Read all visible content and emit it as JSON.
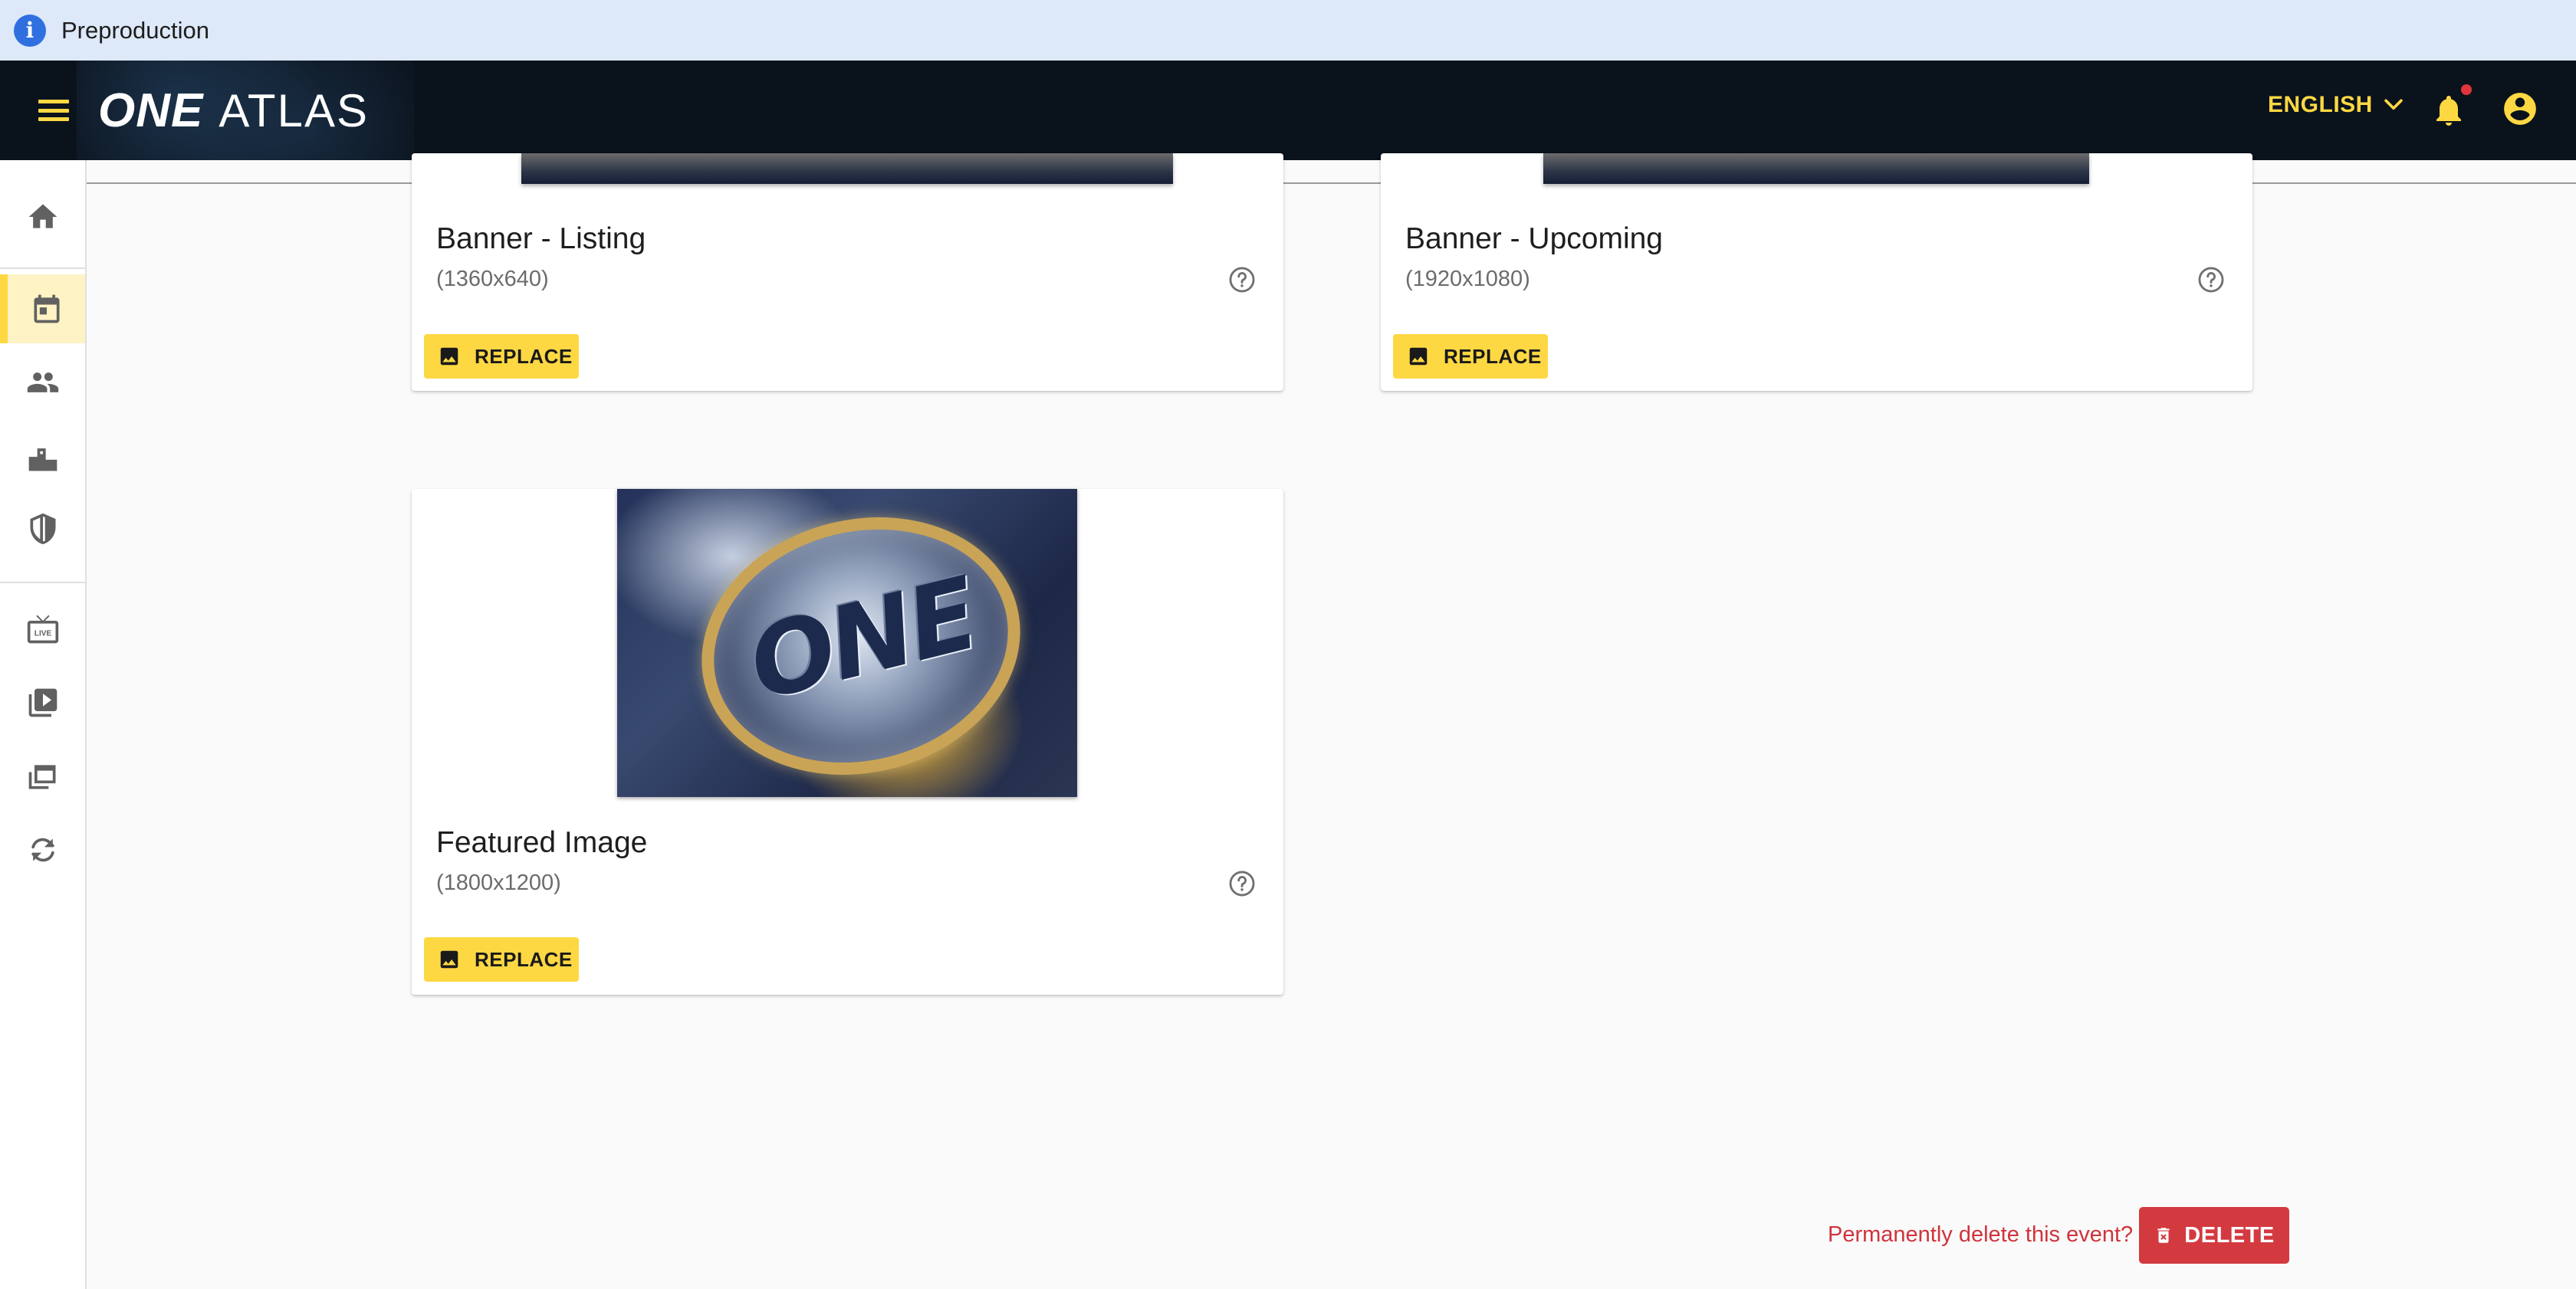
{
  "env_banner": {
    "icon": "info-icon",
    "text": "Preproduction"
  },
  "appbar": {
    "logo_one": "ONE",
    "logo_atlas": "ATLAS",
    "language": "ENGLISH",
    "colors": {
      "accent": "#fed843",
      "bar": "#0a121c",
      "notification_dot": "#e0353b"
    }
  },
  "sidebar": {
    "items": [
      {
        "name": "home",
        "icon": "home-icon",
        "active": false
      },
      {
        "name": "events",
        "icon": "calendar-icon",
        "active": true
      },
      {
        "name": "athletes",
        "icon": "people-icon",
        "active": false
      },
      {
        "name": "rankings",
        "icon": "podium-icon",
        "active": false
      },
      {
        "name": "teams",
        "icon": "shield-icon",
        "active": false
      },
      {
        "name": "live",
        "icon": "live-tv-icon",
        "active": false
      },
      {
        "name": "videos",
        "icon": "video-library-icon",
        "active": false
      },
      {
        "name": "galleries",
        "icon": "image-library-icon",
        "active": false
      },
      {
        "name": "sync",
        "icon": "sync-icon",
        "active": false
      }
    ]
  },
  "cards": [
    {
      "title": "Banner - Listing",
      "size": "(1360x640)",
      "button": "REPLACE"
    },
    {
      "title": "Banner - Upcoming",
      "size": "(1920x1080)",
      "button": "REPLACE"
    },
    {
      "title": "Featured Image",
      "size": "(1800x1200)",
      "button": "REPLACE"
    }
  ],
  "featured_image_text": "ONE",
  "delete": {
    "prompt": "Permanently delete this event?",
    "button": "DELETE",
    "color": "#d33a40"
  }
}
